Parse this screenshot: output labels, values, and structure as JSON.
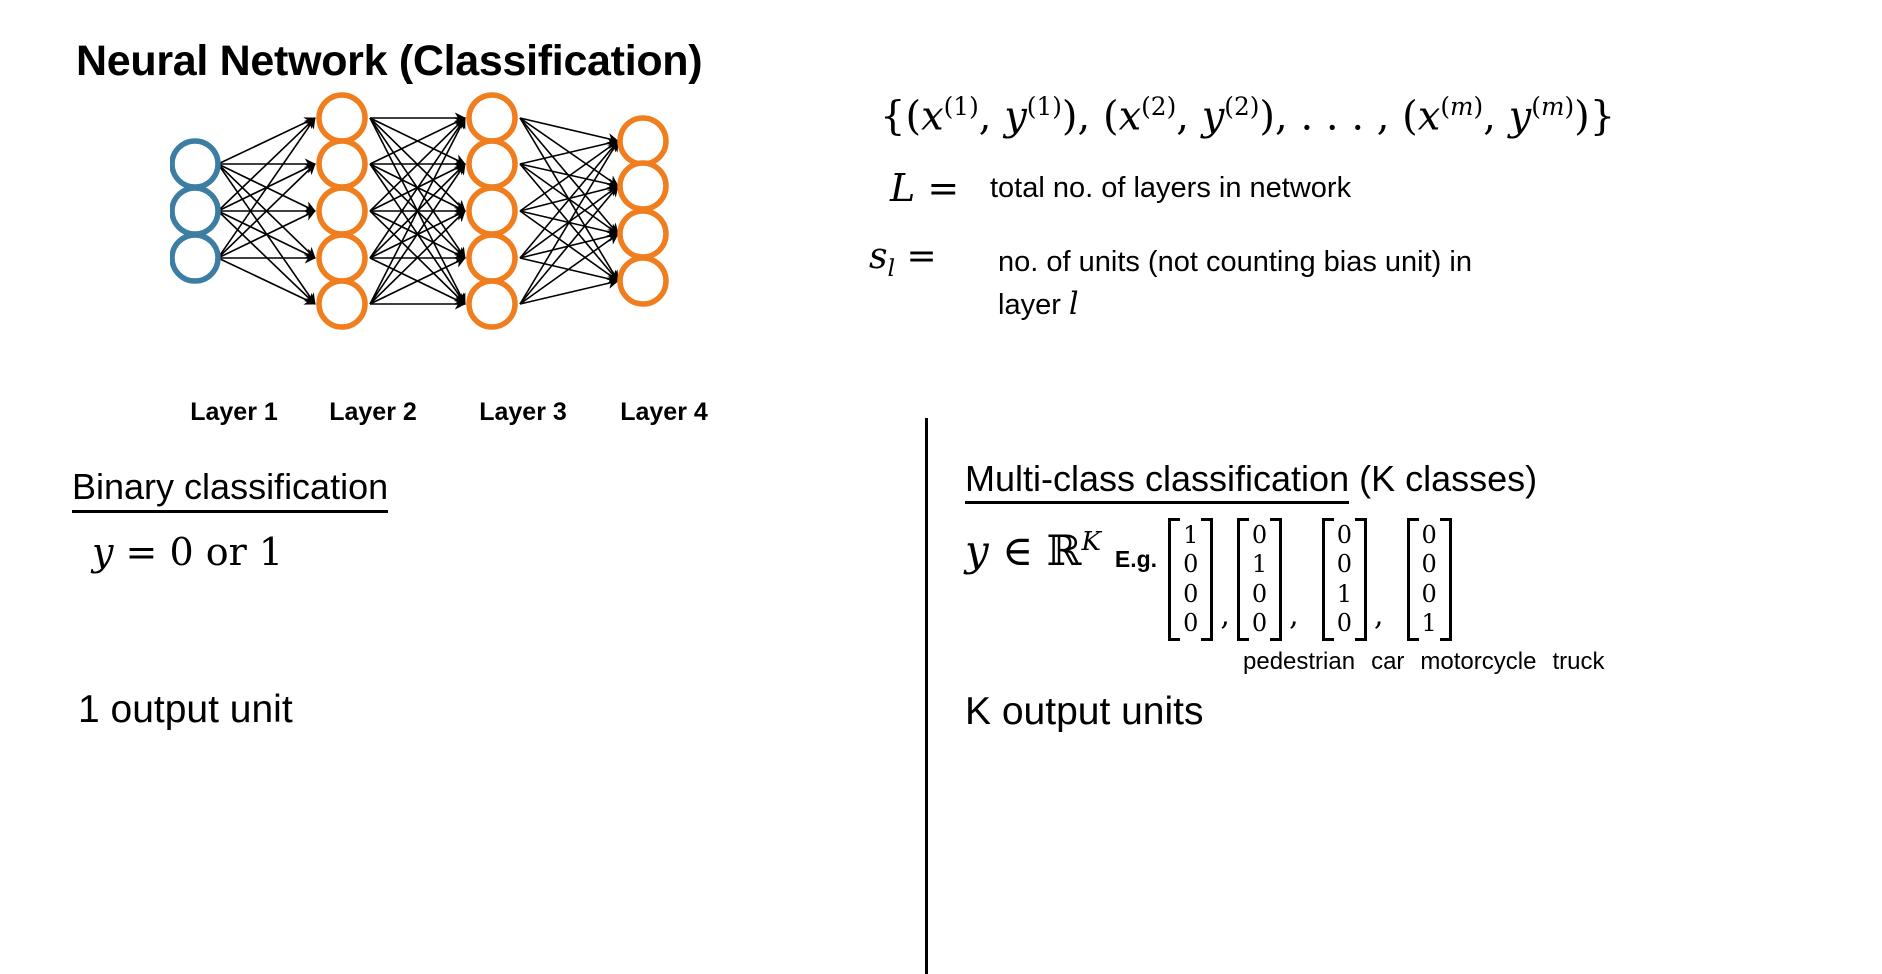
{
  "slide": {
    "title": "Neural Network (Classification)"
  },
  "network": {
    "layers": [
      {
        "label": "Layer 1",
        "units": 3,
        "color": "#3c7ea3",
        "kind": "input"
      },
      {
        "label": "Layer 2",
        "units": 5,
        "color": "#f07d1e",
        "kind": "hidden"
      },
      {
        "label": "Layer 3",
        "units": 5,
        "color": "#f07d1e",
        "kind": "hidden"
      },
      {
        "label": "Layer 4",
        "units": 4,
        "color": "#f07d1e",
        "kind": "output"
      }
    ],
    "edge_color": "#000000"
  },
  "definitions": {
    "training_set": "{(x(1), y(1)), (x(2), y(2)), . . . , (x(m), y(m))}",
    "L_symbol": "L =",
    "L_text": "total no. of layers in network",
    "sl_symbol": "sl =",
    "sl_text_line1": "no. of units (not counting bias unit) in",
    "sl_text_line2_prefix": "layer",
    "sl_text_line2_var": "l"
  },
  "binary": {
    "heading": "Binary classification",
    "formula": "y = 0 or 1",
    "output": "1 output unit"
  },
  "multiclass": {
    "heading_underlined": "Multi-class classification",
    "heading_tail": "(K classes)",
    "y_symbol": "y ∈ ℝK",
    "eg_label": "E.g.",
    "vectors": [
      [
        "1",
        "0",
        "0",
        "0"
      ],
      [
        "0",
        "1",
        "0",
        "0"
      ],
      [
        "0",
        "0",
        "1",
        "0"
      ],
      [
        "0",
        "0",
        "0",
        "1"
      ]
    ],
    "class_labels": [
      "pedestrian",
      "car",
      "motorcycle",
      "truck"
    ],
    "output": "K output units"
  }
}
